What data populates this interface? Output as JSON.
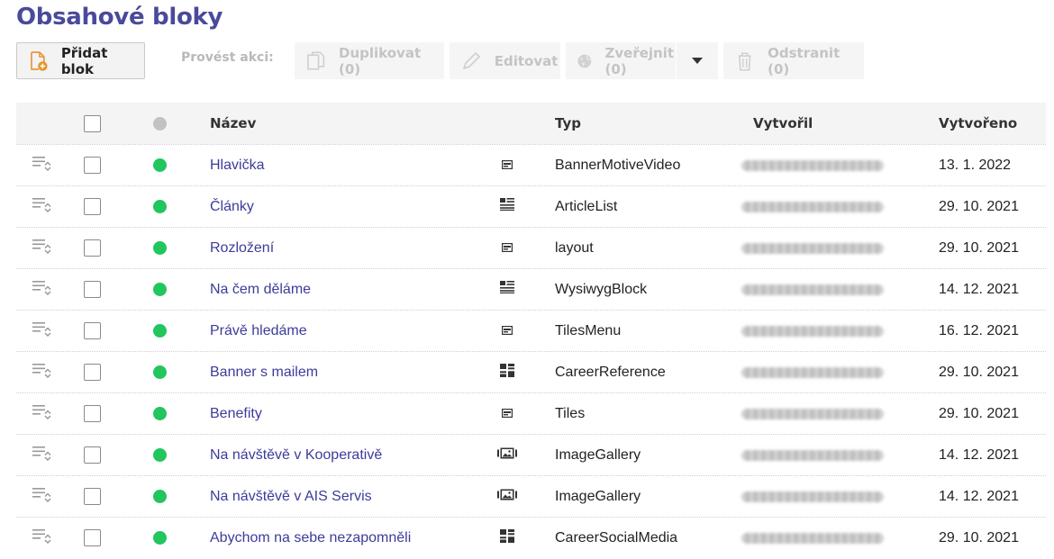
{
  "page": {
    "title": "Obsahové bloky"
  },
  "toolbar": {
    "add_label": "Přidat blok",
    "action_label": "Provést akci:",
    "duplicate_label": "Duplikovat (0)",
    "edit_label": "Editovat",
    "publish_label": "Zveřejnit (0)",
    "delete_label": "Odstranit (0)"
  },
  "table": {
    "headers": {
      "name": "Název",
      "type": "Typ",
      "creator": "Vytvořil",
      "created": "Vytvořeno"
    },
    "status_color": "#22c55e",
    "rows": [
      {
        "name": "Hlavička",
        "icon": "banner-icon",
        "type": "BannerMotiveVideo",
        "date": "13. 1. 2022"
      },
      {
        "name": "Články",
        "icon": "list-icon",
        "type": "ArticleList",
        "date": "29. 10. 2021"
      },
      {
        "name": "Rozložení",
        "icon": "banner-icon",
        "type": "layout",
        "date": "29. 10. 2021"
      },
      {
        "name": "Na čem děláme",
        "icon": "list-icon",
        "type": "WysiwygBlock",
        "date": "14. 12. 2021"
      },
      {
        "name": "Právě hledáme",
        "icon": "banner-icon",
        "type": "TilesMenu",
        "date": "16. 12. 2021"
      },
      {
        "name": "Banner s mailem",
        "icon": "grid-icon",
        "type": "CareerReference",
        "date": "29. 10. 2021"
      },
      {
        "name": "Benefity",
        "icon": "banner-icon",
        "type": "Tiles",
        "date": "29. 10. 2021"
      },
      {
        "name": "Na návštěvě v Kooperativě",
        "icon": "gallery-icon",
        "type": "ImageGallery",
        "date": "14. 12. 2021"
      },
      {
        "name": "Na návštěvě v AIS Servis",
        "icon": "gallery-icon",
        "type": "ImageGallery",
        "date": "14. 12. 2021"
      },
      {
        "name": "Abychom na sebe nezapomněli",
        "icon": "grid-icon",
        "type": "CareerSocialMedia",
        "date": "29. 10. 2021"
      }
    ]
  }
}
